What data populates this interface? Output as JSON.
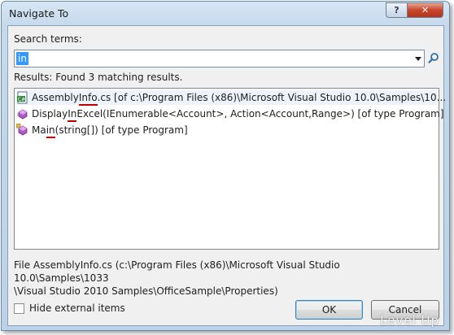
{
  "window": {
    "title": "Navigate To"
  },
  "title_buttons": {
    "help": "?",
    "close": "✕"
  },
  "search": {
    "label": "Search terms:",
    "value": "in"
  },
  "results": {
    "status": "Results: Found 3 matching results.",
    "items": [
      {
        "pre": "Assembly",
        "match": "Info",
        "post": ".cs [of c:\\Program Files (x86)\\Microsoft Visual Studio 10.0\\Samples\\10...",
        "icon": "cs-file-icon",
        "selected": true
      },
      {
        "pre": "Display",
        "match": "In",
        "post": "Excel(IEnumerable<Account>, Action<Account,Range>) [of type Program]",
        "icon": "method-icon",
        "selected": false
      },
      {
        "pre": "Ma",
        "match": "in",
        "post": "(string[]) [of type Program]",
        "icon": "method-icon",
        "selected": false
      }
    ]
  },
  "details": {
    "line1": "File AssemblyInfo.cs (c:\\Program Files (x86)\\Microsoft Visual Studio 10.0\\Samples\\1033",
    "line2": "\\Visual Studio 2010 Samples\\OfficeSample\\Properties)"
  },
  "hide_external": {
    "label": "Hide external items",
    "checked": false
  },
  "buttons": {
    "ok": "OK",
    "cancel": "Cancel"
  },
  "watermark": "Level Up",
  "colors": {
    "accent": "#3399ff",
    "highlight_underline": "#c00000",
    "selected_row": "#eef3fb"
  }
}
